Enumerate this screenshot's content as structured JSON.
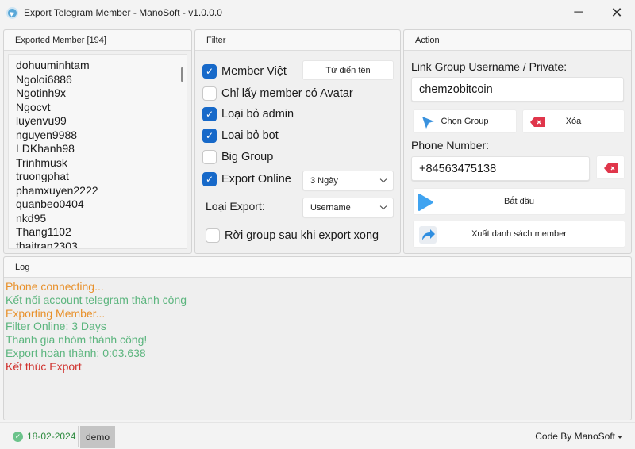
{
  "window": {
    "title": "Export Telegram Member - ManoSoft - v1.0.0.0",
    "minimize_glyph": "─",
    "close_glyph": "✕"
  },
  "members_panel": {
    "header": "Exported Member [194]",
    "items": [
      "dohuuminhtam",
      "Ngoloi6886",
      "Ngotinh9x",
      "Ngocvt",
      "luyenvu99",
      "nguyen9988",
      "LDKhanh98",
      "Trinhmusk",
      "truongphat",
      "phamxuyen2222",
      "quanbeo0404",
      "nkd95",
      "Thang1102",
      "thaitran2303"
    ]
  },
  "filter_panel": {
    "header": "Filter",
    "member_viet": {
      "label": "Member Việt",
      "checked": true
    },
    "dictionary_button": "Từ điển tên",
    "avatar_only": {
      "label": "Chỉ lấy member có Avatar",
      "checked": false
    },
    "exclude_admin": {
      "label": "Loại bỏ admin",
      "checked": true
    },
    "exclude_bot": {
      "label": "Loại bỏ bot",
      "checked": true
    },
    "big_group": {
      "label": "Big Group",
      "checked": false
    },
    "export_online": {
      "label": "Export Online",
      "checked": true
    },
    "online_range": {
      "selected": "3 Ngày"
    },
    "export_type_label": "Loại Export:",
    "export_type": {
      "selected": "Username"
    },
    "leave_group": {
      "label": "Rời group sau khi export xong",
      "checked": false
    }
  },
  "action_panel": {
    "header": "Action",
    "link_label": "Link Group Username / Private:",
    "link_value": "chemzobitcoin",
    "choose_group_button": "Chọn Group",
    "clear_button": "Xóa",
    "phone_label": "Phone Number:",
    "phone_value": "+84563475138",
    "start_button": "Bắt đầu",
    "export_button": "Xuất danh sách member"
  },
  "log_panel": {
    "header": "Log",
    "lines": [
      {
        "text": "Phone connecting...",
        "color": "#e8902a"
      },
      {
        "text": "Kết nối account telegram thành công",
        "color": "#5cb57e"
      },
      {
        "text": "Exporting Member...",
        "color": "#e8902a"
      },
      {
        "text": "Filter Online: 3 Days",
        "color": "#5cb57e"
      },
      {
        "text": "Thanh gia nhóm thành công!",
        "color": "#5cb57e"
      },
      {
        "text": "Export hoàn thành: 0:03.638",
        "color": "#5cb57e"
      },
      {
        "text": "Kết thúc Export",
        "color": "#d0312d"
      }
    ]
  },
  "statusbar": {
    "date": "18-02-2024",
    "user": "demo",
    "credit": "Code By ManoSoft"
  },
  "colors": {
    "accent": "#1769c9",
    "clear_red": "#e0364b",
    "play_blue": "#3fa3f0",
    "status_green": "#2d8a3e"
  }
}
